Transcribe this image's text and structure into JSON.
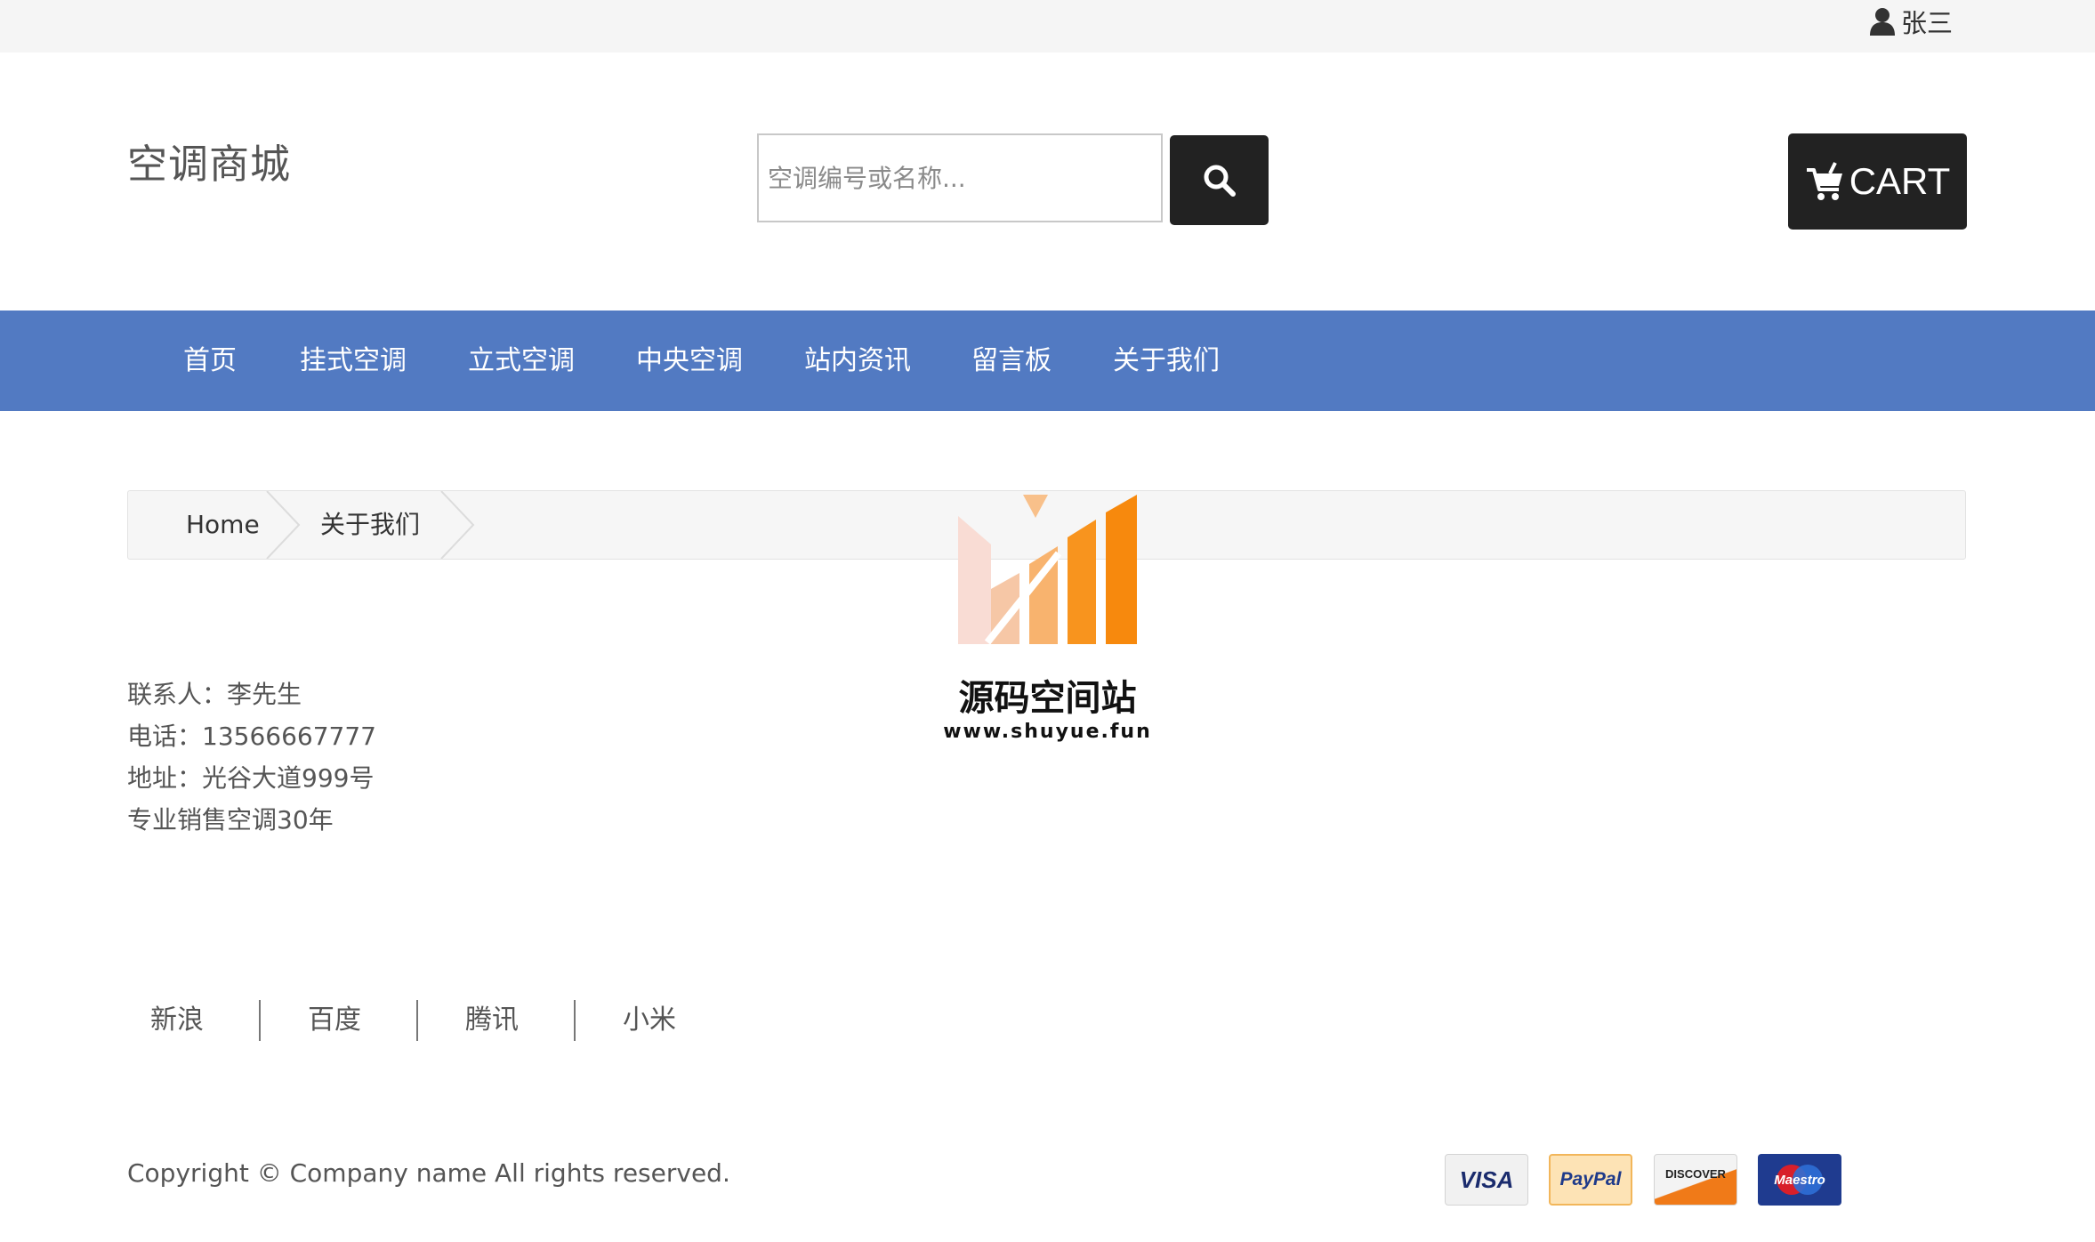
{
  "topbar": {
    "username": "张三"
  },
  "header": {
    "logo": "空调商城",
    "search_placeholder": "空调编号或名称...",
    "cart_label": "CART"
  },
  "nav": [
    "首页",
    "挂式空调",
    "立式空调",
    "中央空调",
    "站内资讯",
    "留言板",
    "关于我们"
  ],
  "breadcrumb": {
    "home": "Home",
    "current": "关于我们"
  },
  "watermark": {
    "title": "源码空间站",
    "url": "www.shuyue.fun"
  },
  "contact": {
    "person": "联系人：李先生",
    "phone": "电话：13566667777",
    "address": "地址：光谷大道999号",
    "slogan": "专业销售空调30年"
  },
  "footer_links": [
    "新浪",
    "百度",
    "腾讯",
    "小米"
  ],
  "copyright": "Copyright © Company name All rights reserved.",
  "payment": {
    "visa": "VISA",
    "paypal": "PayPal",
    "discover": "DISCOVER",
    "maestro": "Maestro"
  },
  "colors": {
    "nav_bg": "#527ac2",
    "dark_button": "#222222",
    "topbar_bg": "#f5f5f5"
  }
}
